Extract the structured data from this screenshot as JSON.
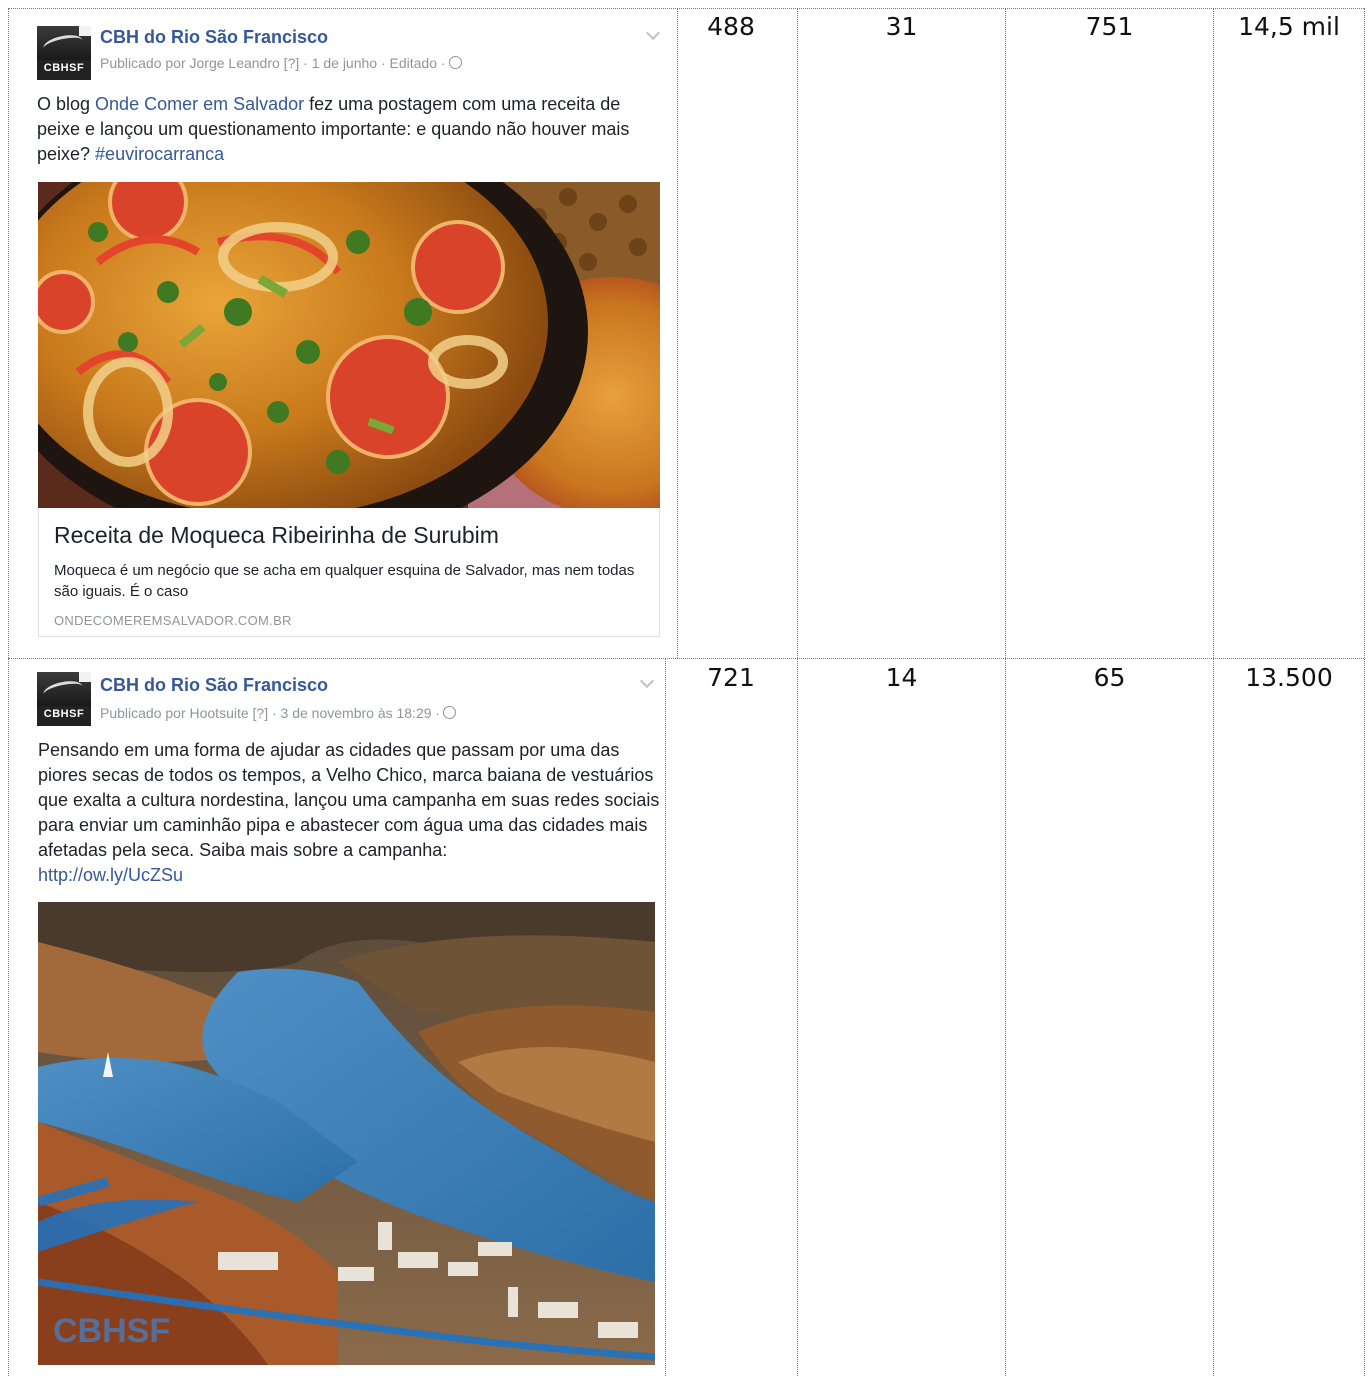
{
  "rows": [
    {
      "post": {
        "logo_text": "CBHSF",
        "page_name": "CBH do Rio São Francisco",
        "meta": "Publicado por Jorge Leandro [?] · 1 de junho · Editado ·",
        "text_before": "O blog ",
        "text_link": "Onde Comer em Salvador",
        "text_after": " fez uma postagem com uma receita de peixe e lançou um questionamento importante: e quando não houver mais peixe? ",
        "hashtag": "#euvirocarranca",
        "photo": "moqueca-photo",
        "link_title": "Receita de Moqueca Ribeirinha de Surubim",
        "link_desc": "Moqueca é um negócio que se acha em qualquer esquina de Salvador, mas nem todas são iguais. É o caso",
        "link_domain": "ONDECOMEREMSALVADOR.COM.BR"
      },
      "values": [
        "488",
        "31",
        "751",
        "14,5 mil"
      ]
    },
    {
      "post": {
        "logo_text": "CBHSF",
        "page_name": "CBH do Rio São Francisco",
        "meta": "Publicado por Hootsuite [?] · 3 de novembro às 18:29 ·",
        "text": "Pensando em uma forma de ajudar as cidades que passam por uma das piores secas de todos os tempos, a Velho Chico, marca baiana de vestuários que exalta a cultura nordestina, lançou uma campanha em suas redes sociais para enviar um caminhão pipa e abastecer com água uma das cidades mais afetadas pela seca. Saiba mais sobre a campanha:",
        "url": "http://ow.ly/UcZSu",
        "photo": "river-photo",
        "watermark": "CBHSF"
      },
      "values": [
        "721",
        "14",
        "65",
        "13.500"
      ]
    }
  ],
  "colors": {
    "link": "#365899",
    "meta": "#90949c",
    "text": "#1d2129",
    "grid": "#7a7a7a"
  }
}
